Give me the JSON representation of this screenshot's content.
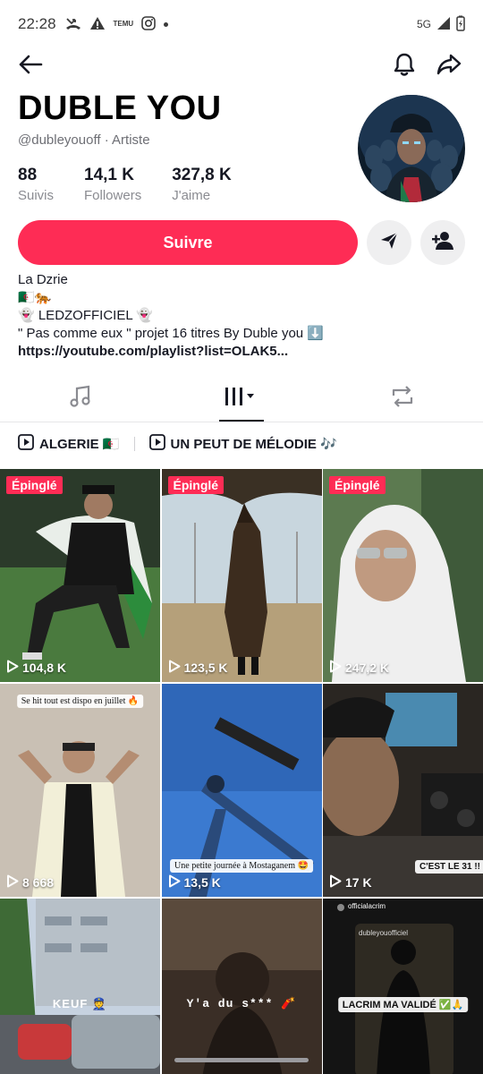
{
  "status_bar": {
    "time": "22:28",
    "temu_label": "TEMU",
    "network": "5G"
  },
  "nav": {
    "back_icon": "arrow-left-icon",
    "bell_icon": "bell-icon",
    "share_icon": "share-icon"
  },
  "profile": {
    "display_name": "DUBLE YOU",
    "handle": "@dubleyouoff",
    "separator": "·",
    "category": "Artiste",
    "stats": [
      {
        "value": "88",
        "label": "Suivis"
      },
      {
        "value": "14,1 K",
        "label": "Followers"
      },
      {
        "value": "327,8 K",
        "label": "J'aime"
      }
    ],
    "follow_label": "Suivre",
    "bio": {
      "line1": "La Dzrie",
      "line2": "🇩🇿🐅",
      "line3": "👻 LEDZOFFICIEL 👻",
      "line4": "\" Pas comme eux  \" projet 16 titres By Duble you ⬇️",
      "link": "https://youtube.com/playlist?list=OLAK5..."
    }
  },
  "tabs": [
    {
      "name": "tab-music",
      "icon": "music-note-icon"
    },
    {
      "name": "tab-videos",
      "icon": "grid-icon",
      "active": true
    },
    {
      "name": "tab-reposts",
      "icon": "repost-icon"
    }
  ],
  "playlists": [
    {
      "label": "ALGERIE 🇩🇿"
    },
    {
      "label": "UN PEUT DE MÉLODIE 🎶"
    }
  ],
  "videos": [
    {
      "views": "104,8 K",
      "pinned": "Épinglé"
    },
    {
      "views": "123,5 K",
      "pinned": "Épinglé"
    },
    {
      "views": "247,2 K",
      "pinned": "Épinglé"
    },
    {
      "views": "8 668",
      "caption": "Se hit tout est dispo en juillet 🔥"
    },
    {
      "views": "13,5 K",
      "caption": "Une petite journée à Mostaganem 🤩"
    },
    {
      "views": "17 K",
      "caption": "C'EST LE 31 !!"
    },
    {
      "caption": "KEUF 👮"
    },
    {
      "caption": "Y'a du s*** 🧨"
    },
    {
      "caption": "LACRIM MA VALIDÉ ✅🙏",
      "small_top": "officialacrim",
      "small_mid": "dubleyouofficiel"
    }
  ],
  "colors": {
    "accent": "#fe2c55",
    "text": "#161823",
    "muted": "#8a8b91"
  }
}
